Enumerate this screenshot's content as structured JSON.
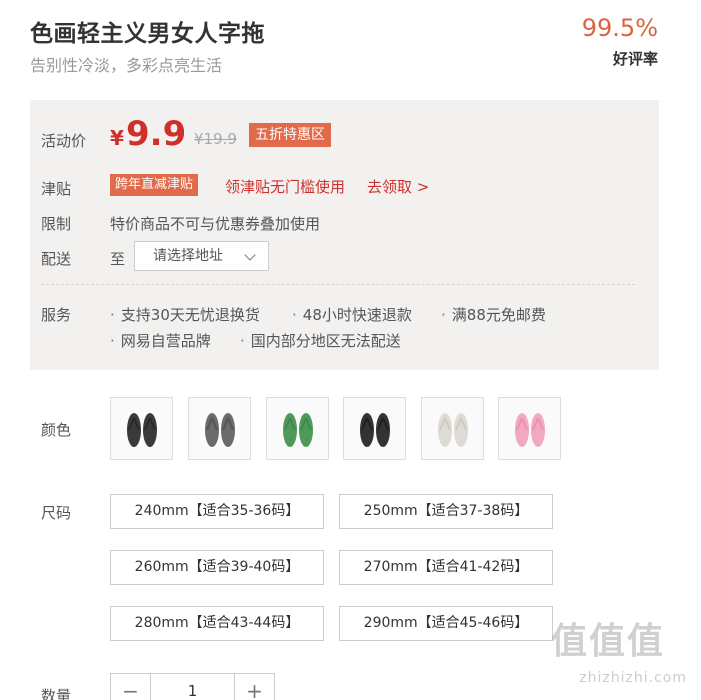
{
  "product": {
    "title": "色画轻主义男女人字拖",
    "subtitle": "告别性冷淡，多彩点亮生活",
    "rating_value": "99.5%",
    "rating_label": "好评率"
  },
  "price": {
    "label": "活动价",
    "currency": "¥",
    "current": "9.9",
    "original": "¥19.9",
    "promo": "五折特惠区"
  },
  "subsidy": {
    "label": "津贴",
    "tag": "跨年直减津贴",
    "link": "领津贴无门槛使用",
    "claim": "去领取 >"
  },
  "limit": {
    "label": "限制",
    "text": "特价商品不可与优惠券叠加使用"
  },
  "shipping": {
    "label": "配送",
    "to": "至",
    "placeholder": "请选择地址"
  },
  "services": {
    "label": "服务",
    "items": [
      "支持30天无忧退换货",
      "48小时快速退款",
      "满88元免邮费",
      "网易自营品牌",
      "国内部分地区无法配送"
    ]
  },
  "colors": {
    "label": "颜色",
    "options": [
      {
        "name": "black",
        "hex": "#3a3a3a",
        "strap": "#2a2a2a"
      },
      {
        "name": "gray",
        "hex": "#6b6b6b",
        "strap": "#555555"
      },
      {
        "name": "green",
        "hex": "#4f9a5a",
        "strap": "#3f8a4a"
      },
      {
        "name": "black-2",
        "hex": "#333333",
        "strap": "#222222"
      },
      {
        "name": "off-white",
        "hex": "#dedad4",
        "strap": "#cfcac3"
      },
      {
        "name": "pink",
        "hex": "#f1a8c2",
        "strap": "#e993b1"
      }
    ]
  },
  "sizes": {
    "label": "尺码",
    "options": [
      "240mm【适合35-36码】",
      "250mm【适合37-38码】",
      "260mm【适合39-40码】",
      "270mm【适合41-42码】",
      "280mm【适合43-44码】",
      "290mm【适合45-46码】"
    ]
  },
  "quantity": {
    "label": "数量",
    "minus": "−",
    "value": "1",
    "plus": "+"
  },
  "watermark": {
    "glyphs": "值值值",
    "url": "zhizhizhi.com"
  }
}
